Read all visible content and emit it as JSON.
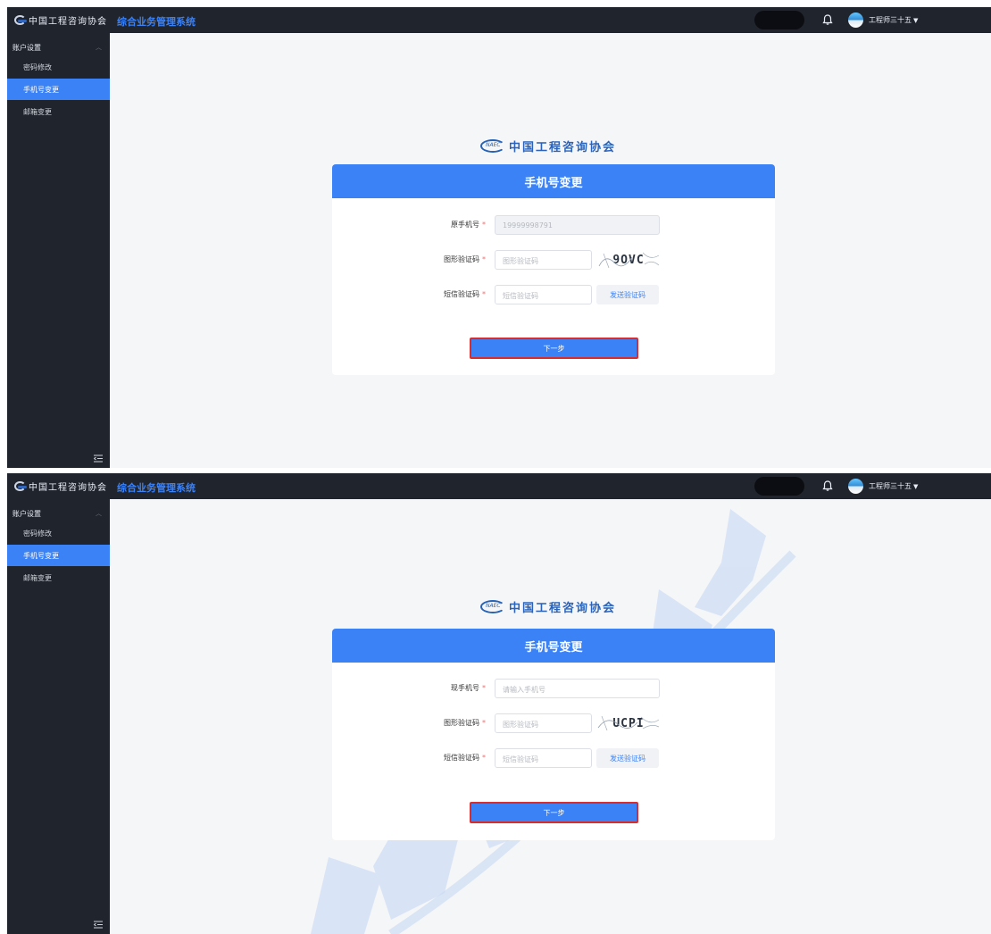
{
  "header": {
    "logo_text": "中国工程咨询协会",
    "system_title": "综合业务管理系统",
    "username": "工程师三十五"
  },
  "sidebar": {
    "group_label": "账户设置",
    "items": [
      {
        "label": "密码修改"
      },
      {
        "label": "手机号变更"
      },
      {
        "label": "邮箱变更"
      }
    ],
    "active_index": 1
  },
  "brand": {
    "logo_text": "中国工程咨询协会"
  },
  "screens": [
    {
      "form_title": "手机号变更",
      "phone_label": "原手机号",
      "phone_value": "19999998791",
      "captcha_label": "图形验证码",
      "captcha_placeholder": "图形验证码",
      "captcha_text": "9OVC",
      "sms_label": "短信验证码",
      "sms_placeholder": "短信验证码",
      "sms_button": "发送验证码",
      "next_button": "下一步"
    },
    {
      "form_title": "手机号变更",
      "phone_label": "现手机号",
      "phone_placeholder": "请输入手机号",
      "captcha_label": "图形验证码",
      "captcha_placeholder": "图形验证码",
      "captcha_text": "UCPI",
      "sms_label": "短信验证码",
      "sms_placeholder": "短信验证码",
      "sms_button": "发送验证码",
      "next_button": "下一步"
    }
  ],
  "colors": {
    "accent": "#3b82f6",
    "topbar": "#20242d",
    "required": "#f56c6c",
    "highlight_border": "#d92c2c"
  }
}
